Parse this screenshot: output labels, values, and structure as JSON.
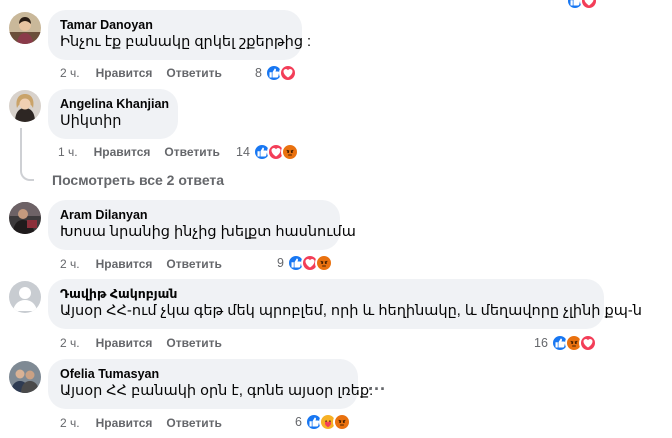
{
  "comments": [
    {
      "author": "Tamar Danoyan",
      "text": "Ինչու էք բանակը զրկել շքերթից :",
      "time": "2 ч.",
      "like_label": "Нравится",
      "reply_label": "Ответить",
      "reaction_count": "8",
      "reactions": [
        "like",
        "love"
      ]
    },
    {
      "author": "Angelina Khanjian",
      "text": "Սիկտիր",
      "time": "1 ч.",
      "like_label": "Нравится",
      "reply_label": "Ответить",
      "reaction_count": "14",
      "reactions": [
        "like",
        "love",
        "angry"
      ]
    },
    {
      "author": "Aram Dilanyan",
      "text": "Խոսա նրանից ինչից խելքտ հասնումա",
      "time": "2 ч.",
      "like_label": "Нравится",
      "reply_label": "Ответить",
      "reaction_count": "9",
      "reactions": [
        "like",
        "love",
        "angry"
      ]
    },
    {
      "author": "Դավիթ Հակոբյան",
      "text": "Այսօր ՀՀ-ում չկա գեթ մեկ պրոբլեմ, որի և հեղինակը, և մեղավորը չլինի քպ-ն",
      "time": "2 ч.",
      "like_label": "Нравится",
      "reply_label": "Ответить",
      "reaction_count": "16",
      "reactions": [
        "like",
        "angry",
        "love"
      ]
    },
    {
      "author": "Ofelia Tumasyan",
      "text": "Այսօր ՀՀ բանակի օրն է, գոնե այսօր լռեք:",
      "time": "2 ч.",
      "like_label": "Нравится",
      "reply_label": "Ответить",
      "reaction_count": "6",
      "reactions": [
        "like",
        "care",
        "angry"
      ]
    }
  ],
  "view_replies_label": "Посмотреть все 2 ответа",
  "more_options_label": "...",
  "colors": {
    "bubble": "#f0f2f5",
    "secondary_text": "#65676b",
    "like": "#1877f2",
    "love": "#f33e58",
    "angry": "#e9710f",
    "care": "#f7b125"
  },
  "icons": {
    "like": "thumbs-up-icon",
    "love": "heart-icon",
    "angry": "angry-face-icon",
    "care": "care-face-icon"
  }
}
